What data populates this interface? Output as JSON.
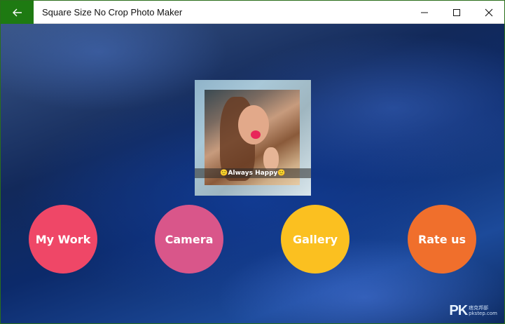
{
  "window": {
    "title": "Square Size No Crop Photo Maker",
    "controls": {
      "minimize": "minimize-icon",
      "maximize": "maximize-icon",
      "close": "close-icon"
    },
    "back_icon": "arrow-left-icon",
    "accent": "#1e7a12"
  },
  "photo": {
    "caption": "🙂Always Happy🙂"
  },
  "actions": [
    {
      "label": "My Work",
      "color": "#ef4767"
    },
    {
      "label": "Camera",
      "color": "#d9568a"
    },
    {
      "label": "Gallery",
      "color": "#fbc020"
    },
    {
      "label": "Rate us",
      "color": "#f06f2c"
    }
  ],
  "watermark": {
    "logo": "PK",
    "text_line1": "痞克邦部",
    "text_line2": "pkstep.com"
  }
}
